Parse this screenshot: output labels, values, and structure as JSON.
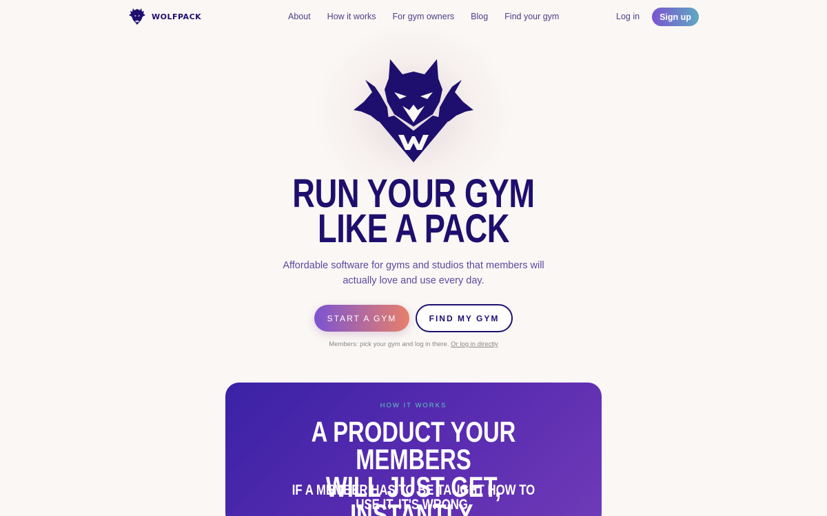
{
  "brand": {
    "name": "WOLFPACK",
    "logo_icon": "wolf-logo-icon",
    "color": "#1e0f6e"
  },
  "nav": {
    "links": [
      "About",
      "How it works",
      "For gym owners",
      "Blog",
      "Find your gym"
    ],
    "login_label": "Log in",
    "signup_label": "Sign up"
  },
  "hero": {
    "logo_icon": "wolf-pack-emblem-icon",
    "title_line1": "RUN YOUR GYM",
    "title_line2": "LIKE A PACK",
    "subtitle": "Affordable software for gyms and studios that members will actually love and use every day.",
    "start_label": "START A GYM",
    "find_label": "FIND MY GYM",
    "members_note": "Members: pick your gym and log in there.",
    "members_link": "Or log in directly"
  },
  "how_it_works": {
    "eyebrow": "HOW IT WORKS",
    "title_line1": "A PRODUCT YOUR MEMBERS",
    "title_line2": "WILL JUST GET, INSTANTLY.",
    "subtitle": "IF A MEMBER HAS TO BE TAUGHT HOW TO USE IT, IT'S WRONG."
  },
  "colors": {
    "accent": "#1e0f6e",
    "background": "#faf7f4",
    "card_gradient_start": "#3a22a6",
    "card_gradient_end": "#6f3bb8",
    "eyebrow": "#5ec9c0"
  }
}
